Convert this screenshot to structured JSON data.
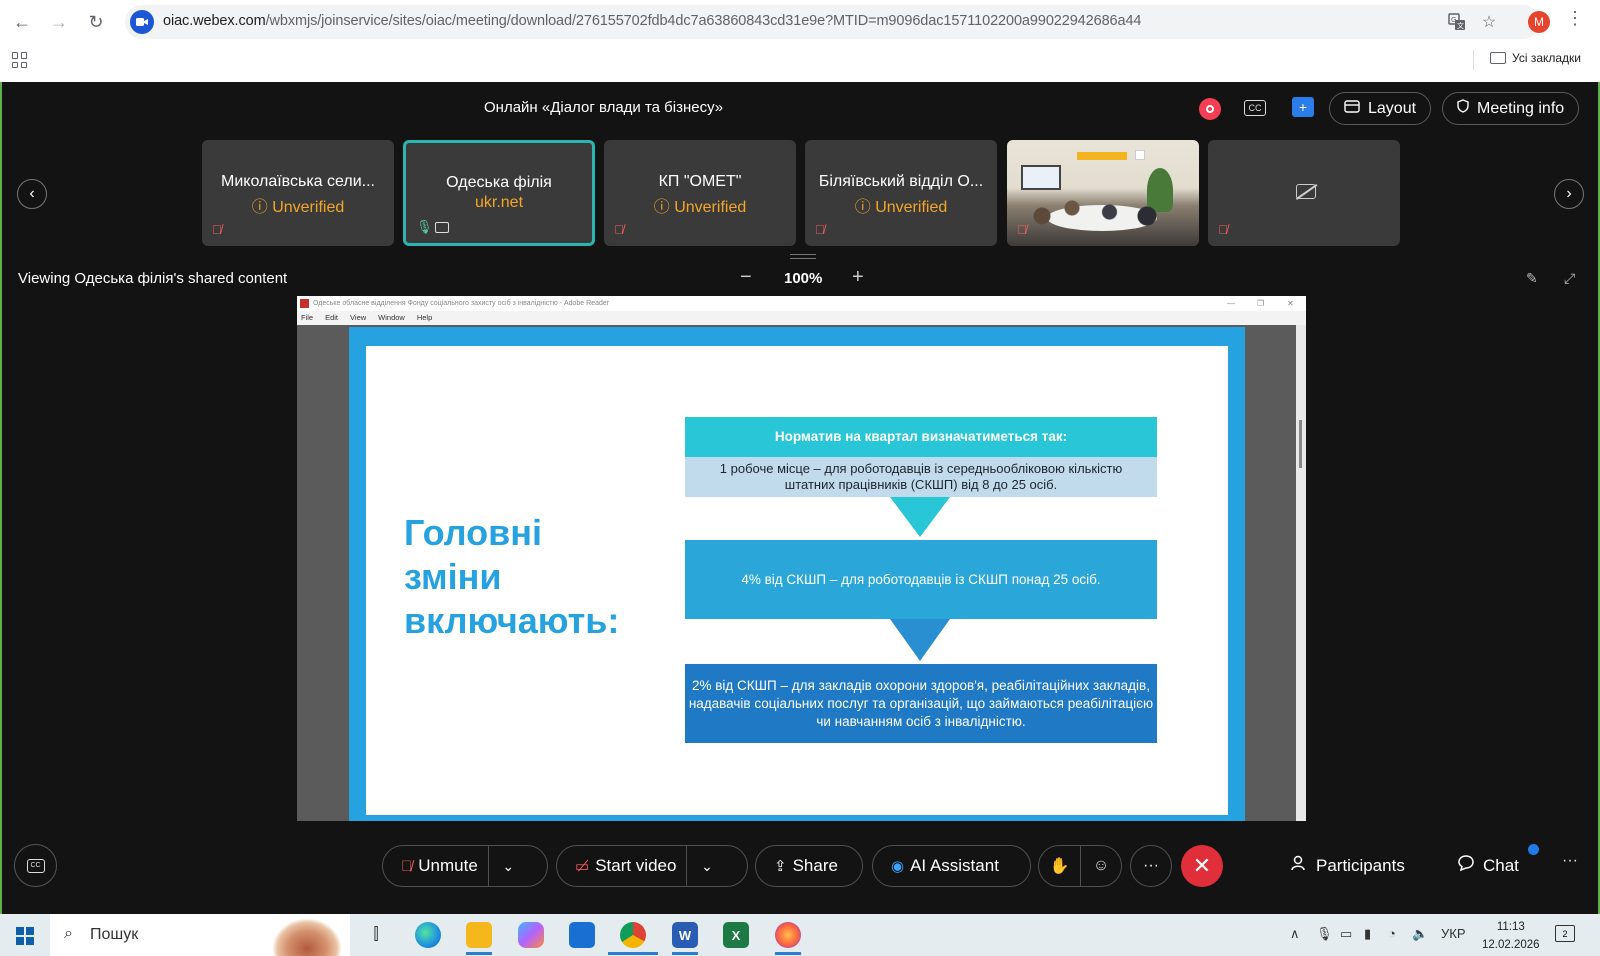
{
  "browser": {
    "url_host": "oiac.webex.com",
    "url_path": "/wbxmjs/joinservice/sites/oiac/meeting/download/276155702fdb4dc7a63860843cd31e9e?MTID=m9096dac1571102200a99022942686a44",
    "profile_initial": "M",
    "bookmarks_label": "Усі закладки"
  },
  "meeting": {
    "title": "Онлайн «Діалог влади та бізнесу»",
    "layout_label": "Layout",
    "meeting_info_label": "Meeting info"
  },
  "participants": [
    {
      "name": "Миколаївська сели...",
      "sub": "Unverified"
    },
    {
      "name": "Одеська філія",
      "sub": "ukr.net"
    },
    {
      "name": "КП \"ОМЕТ\"",
      "sub": "Unverified"
    },
    {
      "name": "Біляївський відділ О...",
      "sub": "Unverified"
    }
  ],
  "share": {
    "viewing_text": "Viewing Одеська філія's shared content",
    "zoom": "100%"
  },
  "adobe": {
    "title": "Одеське обласне відділення Фонду соціального захисту осіб з інвалідністю - Adobe Reader",
    "menu": [
      "File",
      "Edit",
      "View",
      "Window",
      "Help"
    ]
  },
  "slide": {
    "heading": "Головні зміни включають:",
    "box1_title": "Норматив на квартал визначатиметься так:",
    "box1_body": "1 робоче місце – для роботодавців із середньообліковою кількістю штатних працівників (СКШП) від 8 до 25 осіб.",
    "box2": "4% від СКШП – для роботодавців із СКШП понад 25 осіб.",
    "box3": "2% від СКШП – для закладів охорони здоров'я, реабілітаційних закладів, надавачів соціальних послуг та організацій, що займаються реабілітацією чи навчанням осіб з інвалідністю."
  },
  "controls": {
    "unmute": "Unmute",
    "start_video": "Start video",
    "share": "Share",
    "ai_assistant": "AI Assistant",
    "participants": "Participants",
    "chat": "Chat"
  },
  "taskbar": {
    "search_placeholder": "Пошук",
    "language": "УКР",
    "time": "11:13",
    "date": "12.02.2026",
    "notifications": "2"
  }
}
